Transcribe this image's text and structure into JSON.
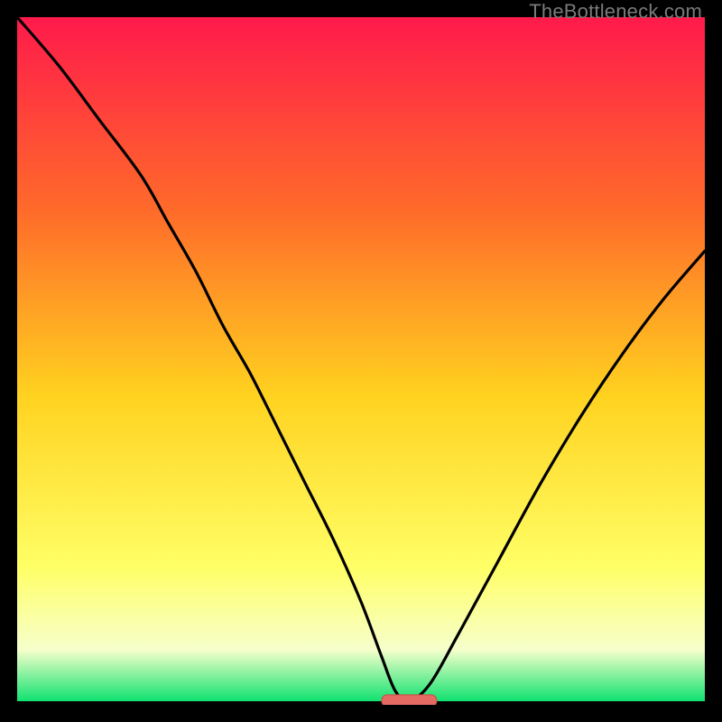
{
  "watermark": "TheBottleneck.com",
  "colors": {
    "gradient_top": "#ff1a4b",
    "gradient_mid1": "#ff6a2a",
    "gradient_mid2": "#ffd21f",
    "gradient_mid3": "#ffff66",
    "gradient_low": "#f6ffcb",
    "gradient_bottom": "#00e06a",
    "curve": "#000000",
    "marker_fill": "#e46a63",
    "marker_stroke": "#c74b44",
    "axis": "#000000"
  },
  "chart_data": {
    "type": "line",
    "title": "",
    "xlabel": "",
    "ylabel": "",
    "xlim": [
      0,
      100
    ],
    "ylim": [
      0,
      100
    ],
    "optimum_x": 57,
    "marker": {
      "x_center": 57,
      "width": 8,
      "y": 0.6
    },
    "series": [
      {
        "name": "bottleneck-curve",
        "x": [
          0,
          6,
          12,
          18,
          22,
          26,
          30,
          34,
          38,
          42,
          46,
          50,
          53,
          55,
          57,
          60,
          64,
          70,
          76,
          82,
          88,
          94,
          100
        ],
        "values": [
          100,
          93,
          85,
          77,
          70,
          63,
          55,
          48,
          40,
          32,
          24,
          15,
          7,
          2,
          0.6,
          3,
          10,
          21,
          32,
          42,
          51,
          59,
          66
        ]
      }
    ]
  }
}
